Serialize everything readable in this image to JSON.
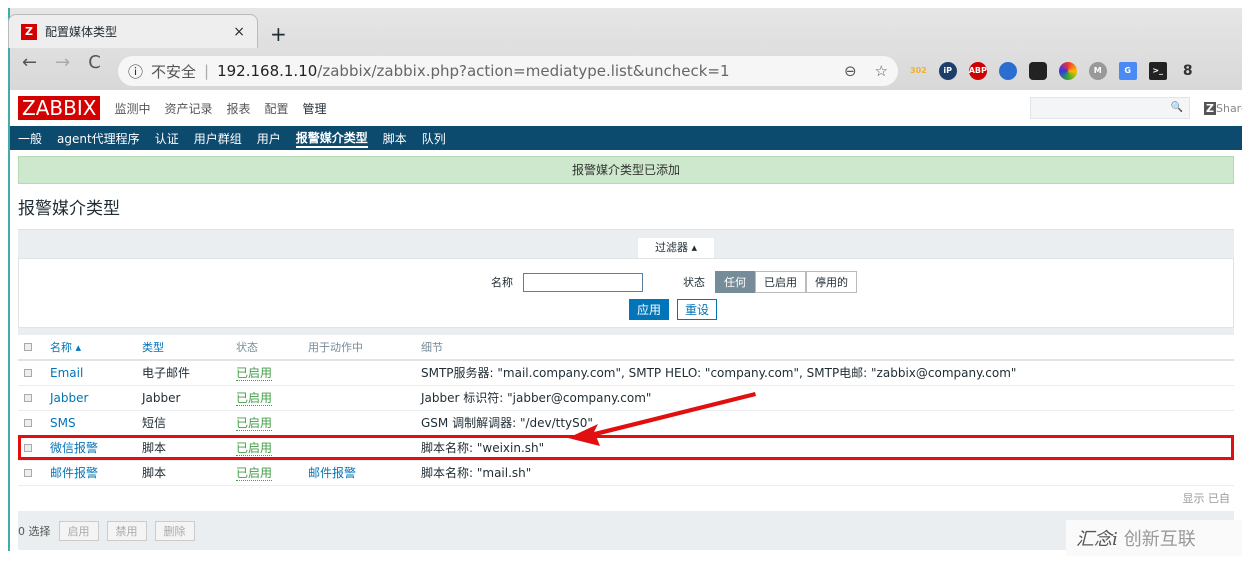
{
  "browser": {
    "tab_title": "配置媒体类型",
    "tab_close": "×",
    "new_tab": "+",
    "nav": {
      "back": "←",
      "forward": "→",
      "reload": "C"
    },
    "insecure_icon": "ⓘ",
    "insecure": "不安全",
    "host": "192.168.1.10",
    "path": "/zabbix/zabbix.php?action=mediatype.list&uncheck=1",
    "zoom_icon": "⊖",
    "star_icon": "☆",
    "extensions": [
      "302",
      "iP",
      "ABP",
      "",
      "",
      "",
      "M",
      "G",
      ">_",
      "8"
    ]
  },
  "header": {
    "logo": "ZABBIX",
    "menu": [
      "监测中",
      "资产记录",
      "报表",
      "配置",
      "管理"
    ],
    "search_icon": "🔍",
    "share": "Share"
  },
  "submenu": [
    "一般",
    "agent代理程序",
    "认证",
    "用户群组",
    "用户",
    "报警媒介类型",
    "脚本",
    "队列"
  ],
  "message": "报警媒介类型已添加",
  "page_title": "报警媒介类型",
  "filter": {
    "tab": "过滤器 ▴",
    "name_label": "名称",
    "name_value": "",
    "status_label": "状态",
    "status_options": [
      "任何",
      "已启用",
      "停用的"
    ],
    "apply": "应用",
    "reset": "重设"
  },
  "table": {
    "headers": [
      "名称 ▴",
      "类型",
      "状态",
      "用于动作中",
      "细节"
    ],
    "rows": [
      {
        "name": "Email",
        "type": "电子邮件",
        "status": "已启用",
        "action": "",
        "details": "SMTP服务器: \"mail.company.com\", SMTP HELO: \"company.com\", SMTP电邮: \"zabbix@company.com\""
      },
      {
        "name": "Jabber",
        "type": "Jabber",
        "status": "已启用",
        "action": "",
        "details": "Jabber 标识符: \"jabber@company.com\""
      },
      {
        "name": "SMS",
        "type": "短信",
        "status": "已启用",
        "action": "",
        "details": "GSM 调制解调器: \"/dev/ttyS0\""
      },
      {
        "name": "微信报警",
        "type": "脚本",
        "status": "已启用",
        "action": "",
        "details": "脚本名称: \"weixin.sh\""
      },
      {
        "name": "邮件报警",
        "type": "脚本",
        "status": "已启用",
        "action": "邮件报警",
        "details": "脚本名称: \"mail.sh\""
      }
    ],
    "footer": "显示 已自"
  },
  "bottom": {
    "selected": "0 选择",
    "buttons": [
      "启用",
      "禁用",
      "删除"
    ]
  },
  "watermark": {
    "a": "汇念i",
    "b": "创新互联"
  }
}
